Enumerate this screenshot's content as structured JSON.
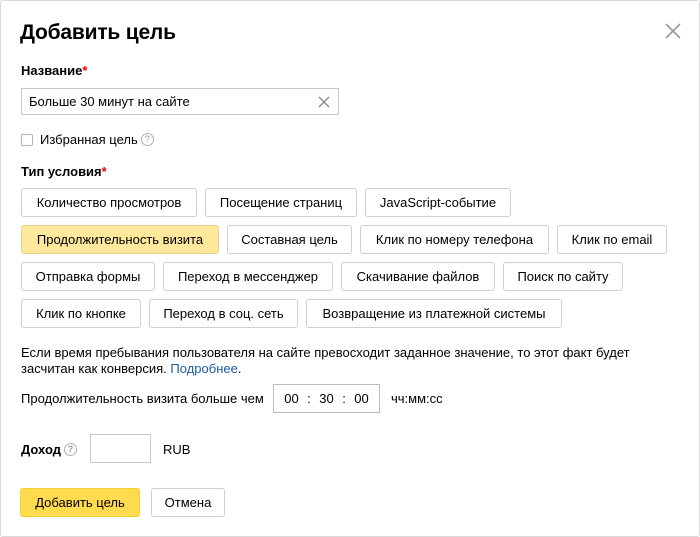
{
  "dialog": {
    "title": "Добавить цель",
    "close_icon": "close-icon"
  },
  "name_field": {
    "label": "Название",
    "required_mark": "*",
    "value": "Больше 30 минут на сайте",
    "clear_icon": "clear-icon"
  },
  "favorite": {
    "label": "Избранная цель",
    "checked": false,
    "help_glyph": "?"
  },
  "condition": {
    "label": "Тип условия",
    "required_mark": "*",
    "active_index": 3,
    "types": [
      "Количество просмотров",
      "Посещение страниц",
      "JavaScript-событие",
      "Продолжительность визита",
      "Составная цель",
      "Клик по номеру телефона",
      "Клик по email",
      "Отправка формы",
      "Переход в мессенджер",
      "Скачивание файлов",
      "Поиск по сайту",
      "Клик по кнопке",
      "Переход в соц. сеть",
      "Возвращение из платежной системы"
    ]
  },
  "description": {
    "text": "Если время пребывания пользователя на сайте превосходит заданное значение, то этот факт будет засчитан как конверсия.",
    "link": "Подробнее",
    "trailing": "."
  },
  "duration": {
    "label": "Продолжительность визита больше чем",
    "hours": "00",
    "minutes": "30",
    "seconds": "00",
    "separator": ":",
    "format_hint": "чч:мм:сс"
  },
  "income": {
    "label": "Доход",
    "help_glyph": "?",
    "value": "",
    "currency": "RUB"
  },
  "actions": {
    "submit_label": "Добавить цель",
    "cancel_label": "Отмена"
  },
  "colors": {
    "active_chip": "#fde89b",
    "primary_button": "#ffdb4d",
    "link": "#1a5ca8",
    "required": "#ee0000"
  }
}
